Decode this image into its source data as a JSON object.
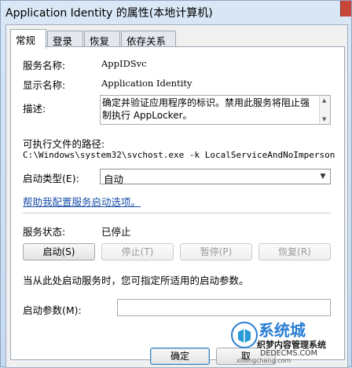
{
  "window": {
    "title": "Application Identity 的属性(本地计算机)"
  },
  "tabs": [
    {
      "label": "常规",
      "active": true
    },
    {
      "label": "登录",
      "active": false
    },
    {
      "label": "恢复",
      "active": false
    },
    {
      "label": "依存关系",
      "active": false
    }
  ],
  "general": {
    "service_name_label": "服务名称:",
    "service_name_value": "AppIDSvc",
    "display_name_label": "显示名称:",
    "display_name_value": "Application Identity",
    "description_label": "描述:",
    "description_value": "确定并验证应用程序的标识。禁用此服务将阻止强制执行 AppLocker。",
    "exec_path_label": "可执行文件的路径:",
    "exec_path_value": "C:\\Windows\\system32\\svchost.exe -k LocalServiceAndNoImperson",
    "startup_type_label": "启动类型(E):",
    "startup_type_value": "自动",
    "help_link": "帮助我配置服务启动选项。",
    "status_label": "服务状态:",
    "status_value": "已停止",
    "buttons": {
      "start": "启动(S)",
      "stop": "停止(T)",
      "pause": "暂停(P)",
      "resume": "恢复(R)"
    },
    "hint_text": "当从此处启动服务时，您可指定所适用的启动参数。",
    "start_params_label": "启动参数(M):",
    "start_params_value": ""
  },
  "footer": {
    "ok": "确定",
    "cancel": "取"
  },
  "watermark": {
    "brand": "系统城",
    "line1": "织梦内容管理系统",
    "line2": "DEDECMS.COM",
    "url": "xitongcheng.com"
  }
}
